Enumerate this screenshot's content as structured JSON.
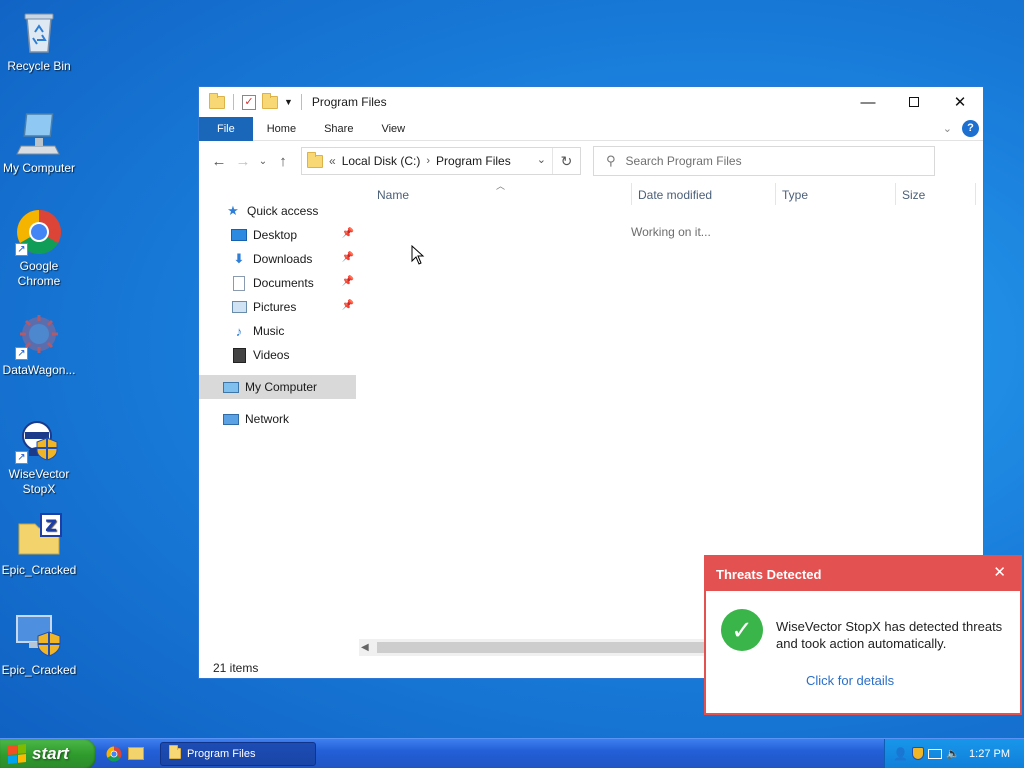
{
  "desktop": {
    "icons": [
      {
        "label": "Recycle Bin",
        "icon": "recycle-bin-icon"
      },
      {
        "label": "My Computer",
        "icon": "computer-icon"
      },
      {
        "label": "Google Chrome",
        "icon": "chrome-icon"
      },
      {
        "label": "DataWagon...",
        "icon": "app-icon"
      },
      {
        "label": "WiseVector StopX",
        "icon": "wisevector-icon"
      },
      {
        "label": "Epic_Cracked",
        "icon": "zip-folder-icon"
      },
      {
        "label": "Epic_Cracked",
        "icon": "shield-monitor-icon"
      }
    ]
  },
  "explorer": {
    "title": "Program Files",
    "ribbon_tabs": [
      "File",
      "Home",
      "Share",
      "View"
    ],
    "address": {
      "prefix": "«",
      "crumbs": [
        "Local Disk (C:)",
        "Program Files"
      ]
    },
    "search_placeholder": "Search Program Files",
    "nav": {
      "quick_access": "Quick access",
      "items": [
        "Desktop",
        "Downloads",
        "Documents",
        "Pictures",
        "Music",
        "Videos"
      ],
      "my_computer": "My Computer",
      "network": "Network"
    },
    "columns": [
      "Name",
      "Date modified",
      "Type",
      "Size"
    ],
    "working_text": "Working on it...",
    "status": "21 items"
  },
  "toast": {
    "title": "Threats Detected",
    "message": "WiseVector StopX has detected threats and took action automatically.",
    "link": "Click for details",
    "accent": "#e35151"
  },
  "taskbar": {
    "start_label": "start",
    "task_label": "Program Files",
    "clock": "1:27 PM"
  }
}
